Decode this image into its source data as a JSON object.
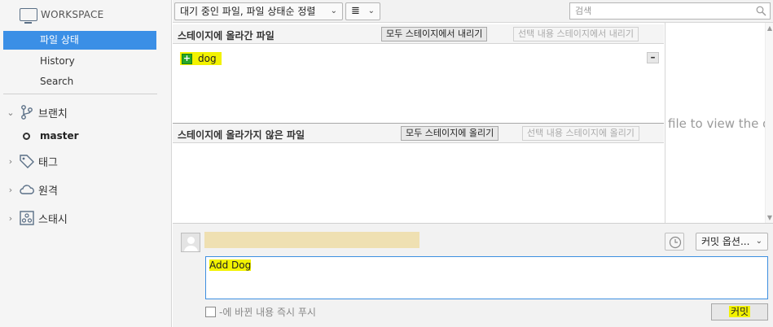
{
  "sidebar": {
    "workspace_label": "WORKSPACE",
    "workspace_items": [
      {
        "label": "파일 상태",
        "active": true
      },
      {
        "label": "History",
        "active": false
      },
      {
        "label": "Search",
        "active": false
      }
    ],
    "groups": {
      "branches": {
        "label": "브랜치",
        "expanded": true
      },
      "tags": {
        "label": "태그",
        "expanded": false
      },
      "remotes": {
        "label": "원격",
        "expanded": false
      },
      "stashes": {
        "label": "스태시",
        "expanded": false
      }
    },
    "current_branch": "master"
  },
  "toolbar": {
    "sort_label": "대기 중인 파일, 파일 상태순 정렬",
    "view_icon": "≣",
    "search_placeholder": "검색"
  },
  "staged": {
    "title": "스테이지에 올라간 파일",
    "unstage_all": "모두 스테이지에서 내리기",
    "unstage_selected": "선택 내용 스테이지에서 내리기",
    "files": [
      {
        "name": "dog",
        "status": "added"
      }
    ]
  },
  "unstaged": {
    "title": "스테이지에 올라가지 않은 파일",
    "stage_all": "모두 스테이지에 올리기",
    "stage_selected": "선택 내용 스테이지에 올리기"
  },
  "diff": {
    "placeholder": "Select a file to view the diff"
  },
  "commit": {
    "options_label": "커밋 옵션...",
    "message": "Add Dog",
    "push_label": "-에 바뀐 내용 즉시 푸시",
    "button_label": "커밋"
  },
  "colors": {
    "accent": "#3b8fe6",
    "highlight": "#f2f200",
    "added": "#27a827"
  }
}
